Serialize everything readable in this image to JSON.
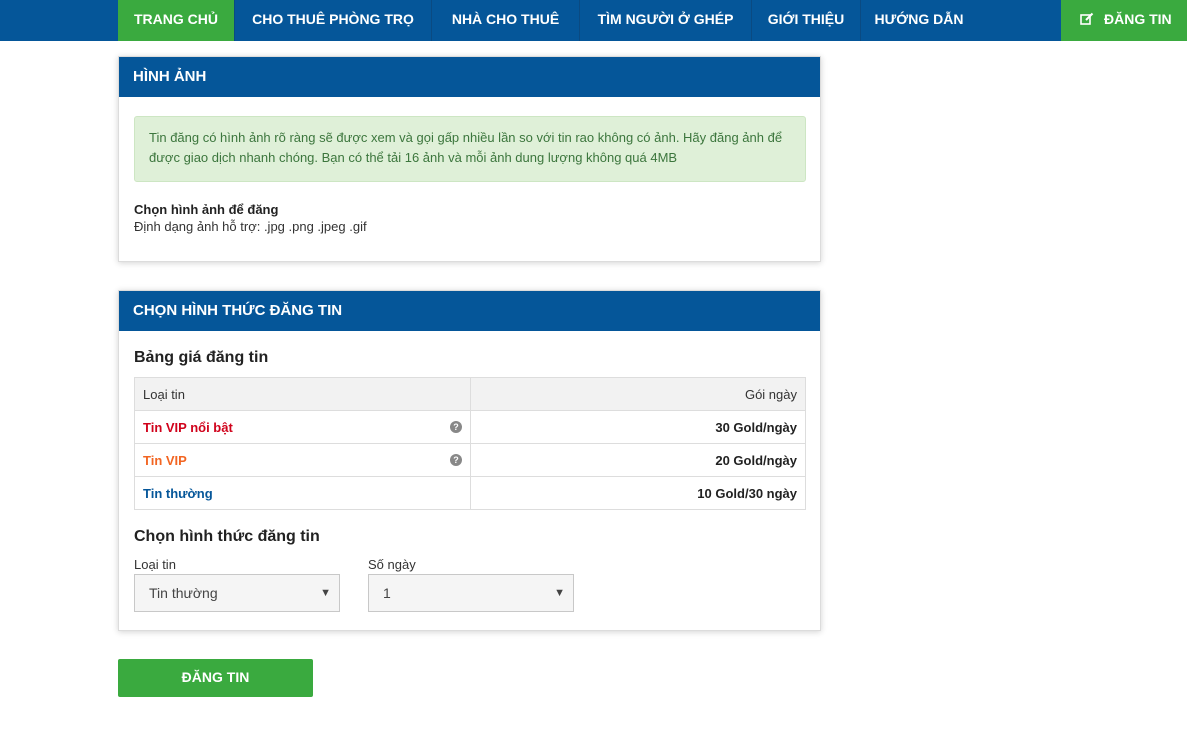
{
  "nav": {
    "items": [
      {
        "label": "TRANG CHỦ"
      },
      {
        "label": "CHO THUÊ PHÒNG TRỌ"
      },
      {
        "label": "NHÀ CHO THUÊ"
      },
      {
        "label": "TÌM NGƯỜI Ở GHÉP"
      },
      {
        "label": "GIỚI THIỆU"
      },
      {
        "label": "HƯỚNG DẪN"
      }
    ],
    "post_label": "ĐĂNG TIN",
    "post_icon": "edit-icon"
  },
  "images_panel": {
    "title": "HÌNH ẢNH",
    "notice": "Tin đăng có hình ảnh rõ ràng sẽ được xem và gọi gấp nhiều lần so với tin rao không có ảnh. Hãy đăng ảnh để được giao dịch nhanh chóng. Bạn có thể tải 16 ảnh và mỗi ảnh dung lượng không quá 4MB",
    "choose_label": "Chọn hình ảnh để đăng",
    "formats": "Định dạng ảnh hỗ trợ: .jpg .png .jpeg .gif"
  },
  "post_type_panel": {
    "title": "CHỌN HÌNH THỨC ĐĂNG TIN",
    "price_title": "Bảng giá đăng tin",
    "table": {
      "headers": [
        "Loại tin",
        "Gói ngày"
      ],
      "rows": [
        {
          "type": "Tin VIP nổi bật",
          "price": "30 Gold/ngày",
          "color": "#d0021b",
          "help": "question-circle-icon"
        },
        {
          "type": "Tin VIP",
          "price": "20 Gold/ngày",
          "color": "#f26522",
          "help": "question-circle-icon"
        },
        {
          "type": "Tin thường",
          "price": "10 Gold/30 ngày",
          "color": "#055699"
        }
      ]
    },
    "choose_title": "Chọn hình thức đăng tin",
    "type_select": {
      "label": "Loại tin",
      "value": "Tin thường"
    },
    "days_select": {
      "label": "Số ngày",
      "value": "1"
    }
  },
  "submit": {
    "label": "ĐĂNG TIN"
  },
  "colors": {
    "primary": "#055699",
    "accent": "#3aaa3f"
  }
}
